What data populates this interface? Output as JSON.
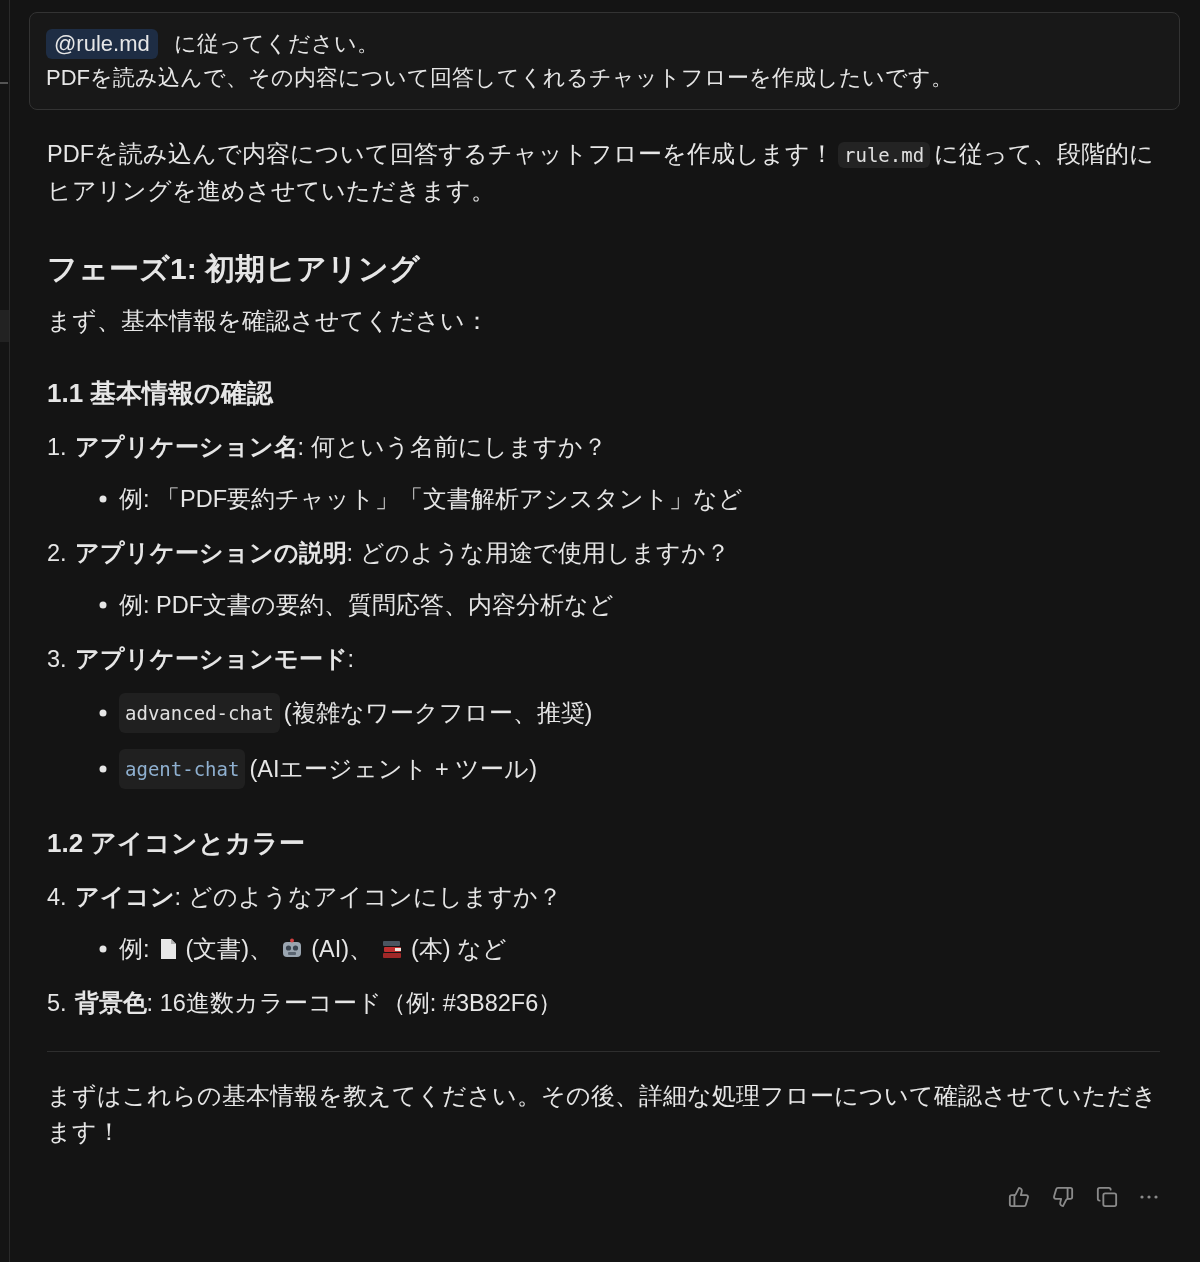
{
  "user_message": {
    "mention": "@rule.md",
    "text": "に従ってください。",
    "line_2": "PDFを読み込んで、その内容について回答してくれるチャットフローを作成したいです。"
  },
  "response": [
    {
      "kind": "paragraph",
      "parts": [
        {
          "kind": "text",
          "text": "PDFを読み込んで内容について回答するチャットフローを作成します！"
        },
        {
          "kind": "code",
          "text": "rule.md"
        },
        {
          "kind": "text",
          "text": "に従って、段階的にヒアリングを進めさせていただきます。"
        }
      ]
    },
    {
      "kind": "h2",
      "text": "フェーズ1: 初期ヒアリング"
    },
    {
      "kind": "paragraph",
      "parts": [
        {
          "kind": "text",
          "text": "まず、基本情報を確認させてください："
        }
      ]
    },
    {
      "kind": "h3",
      "text": "1.1 基本情報の確認"
    },
    {
      "kind": "item",
      "number": "1.",
      "text": "**アプリケーション名**: 何という名前にしますか？",
      "bullets": [
        {
          "parts": [
            {
              "kind": "text",
              "text": "例: 「PDF要約チャット」「文書解析アシスタント」など"
            }
          ]
        }
      ]
    },
    {
      "kind": "item",
      "number": "2.",
      "text": "**アプリケーションの説明**: どのような用途で使用しますか？",
      "bullets": [
        {
          "parts": [
            {
              "kind": "text",
              "text": "例: PDF文書の要約、質問応答、内容分析など"
            }
          ]
        }
      ]
    },
    {
      "kind": "item",
      "number": "3.",
      "text": "**アプリケーションモード**:",
      "bullets": [
        {
          "parts": [
            {
              "kind": "code",
              "text": "advanced-chat",
              "color": "#e0e0e0"
            },
            {
              "kind": "text",
              "text": "(複雑なワークフロー、推奨)"
            }
          ]
        },
        {
          "parts": [
            {
              "kind": "code",
              "text": "agent-chat",
              "color": "#8fb0d0"
            },
            {
              "kind": "text",
              "text": "(AIエージェント + ツール)"
            }
          ]
        }
      ]
    },
    {
      "kind": "h3",
      "text": "1.2 アイコンとカラー"
    },
    {
      "kind": "item",
      "number": "4.",
      "text": "**アイコン**: どのようなアイコンにしますか？",
      "bullets": [
        {
          "parts": [
            {
              "kind": "text",
              "text": "例:"
            },
            {
              "kind": "document"
            },
            {
              "kind": "text",
              "text": "(文書)、"
            },
            {
              "kind": "robot"
            },
            {
              "kind": "text",
              "text": "(AI)、"
            },
            {
              "kind": "books"
            },
            {
              "kind": "text",
              "text": "(本) など"
            }
          ]
        }
      ]
    },
    {
      "kind": "item",
      "number": "5.",
      "text": "**背景色**: 16進数カラーコード（例: #3B82F6）"
    },
    {
      "kind": "rule"
    },
    {
      "kind": "paragraph",
      "parts": [
        {
          "kind": "text",
          "text": "まずはこれらの基本情報を教えてください。その後、詳細な処理フローについて確認させていただきます！"
        }
      ]
    }
  ]
}
